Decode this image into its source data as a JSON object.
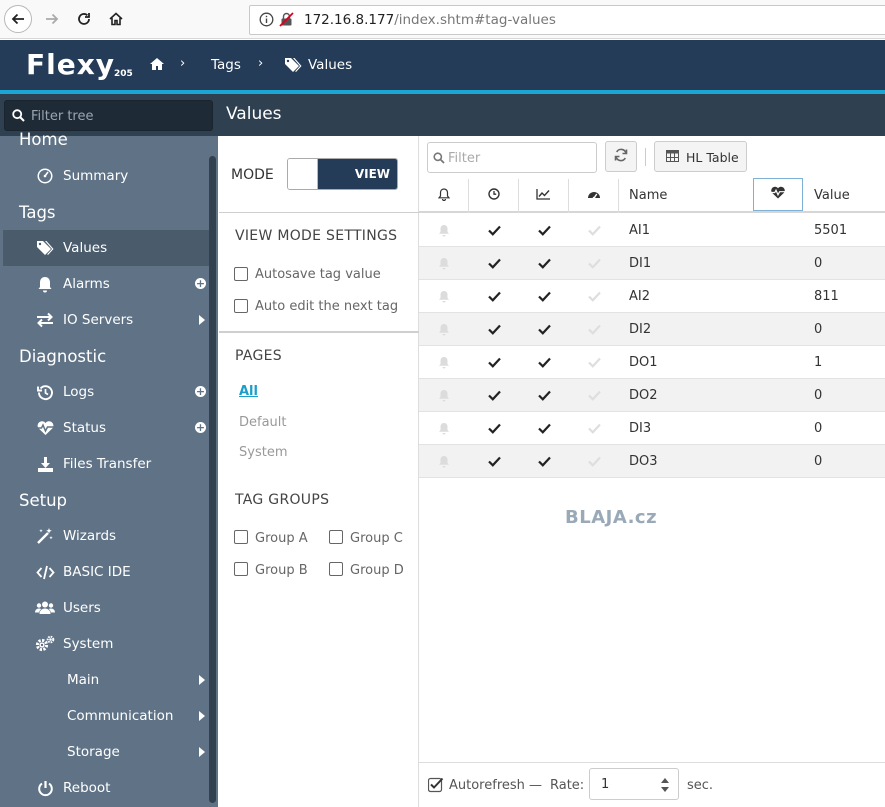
{
  "browser": {
    "url_host": "172.16.8.177",
    "url_path": "/index.shtm#tag-values"
  },
  "header": {
    "logo": "Flexy",
    "logo_sub": "205",
    "breadcrumbs": [
      "Tags",
      "Values"
    ]
  },
  "subbar": {
    "tree_filter_placeholder": "Filter tree",
    "page_title": "Values"
  },
  "sidebar": {
    "sections": {
      "home": "Home",
      "tags": "Tags",
      "diagnostic": "Diagnostic",
      "setup": "Setup"
    },
    "items": {
      "summary": "Summary",
      "values": "Values",
      "alarms": "Alarms",
      "io_servers": "IO Servers",
      "logs": "Logs",
      "status": "Status",
      "files_transfer": "Files Transfer",
      "wizards": "Wizards",
      "basic_ide": "BASIC IDE",
      "users": "Users",
      "system": "System",
      "main": "Main",
      "communication": "Communication",
      "storage": "Storage",
      "reboot": "Reboot"
    }
  },
  "midpanel": {
    "mode_label": "MODE",
    "mode_value": "VIEW",
    "view_settings_title": "VIEW MODE SETTINGS",
    "autosave_label": "Autosave tag value",
    "autoedit_label": "Auto edit the next tag",
    "pages_title": "PAGES",
    "pages": [
      "All",
      "Default",
      "System"
    ],
    "tag_groups_title": "TAG GROUPS",
    "groups": [
      "Group A",
      "Group B",
      "Group C",
      "Group D"
    ]
  },
  "toolbar": {
    "filter_placeholder": "Filter",
    "hl_table_label": "HL Table"
  },
  "table": {
    "columns": {
      "name": "Name",
      "value": "Value"
    },
    "rows": [
      {
        "name": "AI1",
        "value": "5501"
      },
      {
        "name": "DI1",
        "value": "0"
      },
      {
        "name": "AI2",
        "value": "811"
      },
      {
        "name": "DI2",
        "value": "0"
      },
      {
        "name": "DO1",
        "value": "1"
      },
      {
        "name": "DO2",
        "value": "0"
      },
      {
        "name": "DI3",
        "value": "0"
      },
      {
        "name": "DO3",
        "value": "0"
      }
    ]
  },
  "watermark": "BLAJA.cz",
  "footer": {
    "autorefresh_label": "Autorefresh",
    "dash": "—",
    "rate_label": "Rate:",
    "rate_value": "1",
    "unit": "sec."
  },
  "colors": {
    "header_bg": "#243c58",
    "accent": "#1ca6d4",
    "sidebar_bg": "#607386",
    "sidebar_active": "#4a5b6c"
  }
}
